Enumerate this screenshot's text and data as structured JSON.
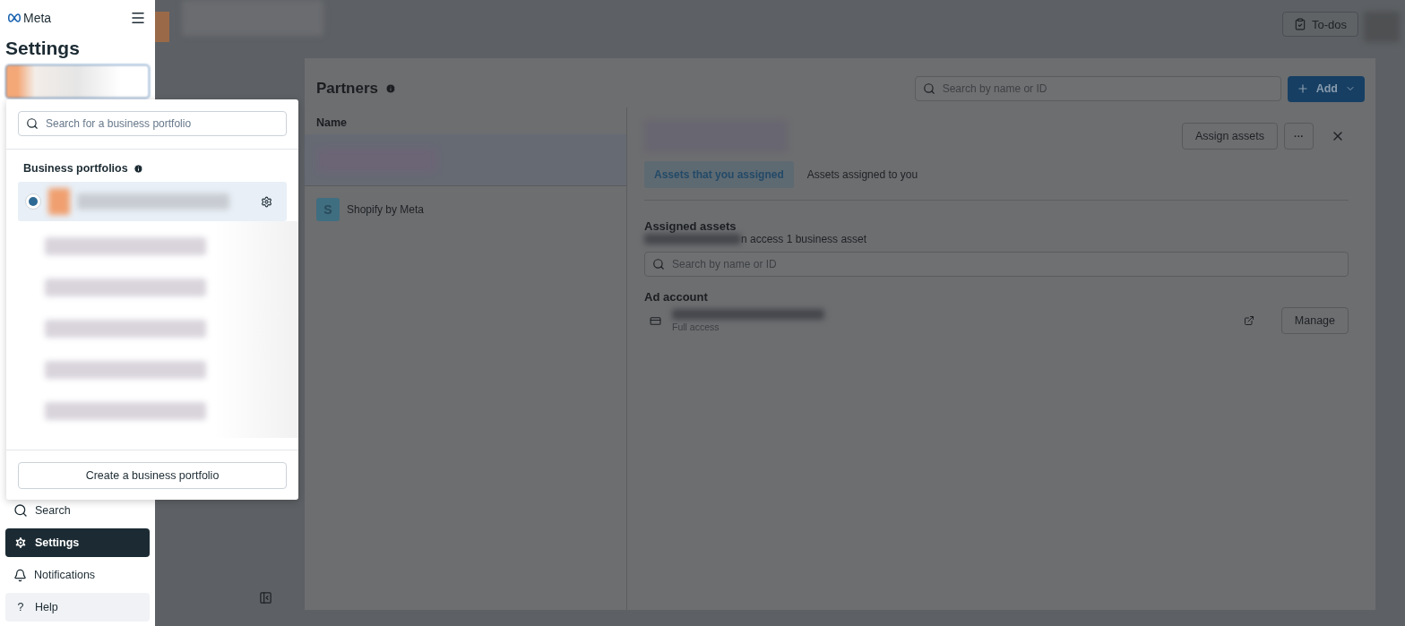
{
  "sidebar": {
    "logo": "Meta",
    "title": "Settings",
    "nav": [
      {
        "label": "Search",
        "selected": false,
        "hovered": false
      },
      {
        "label": "Settings",
        "selected": true,
        "hovered": false
      },
      {
        "label": "Notifications",
        "selected": false,
        "hovered": false
      },
      {
        "glyph": "?",
        "label": "Help",
        "selected": false,
        "hovered": true
      }
    ]
  },
  "topbar": {
    "todos": "To-dos"
  },
  "partners": {
    "title": "Partners",
    "search_placeholder": "Search by name or ID",
    "add": "Add",
    "column": "Name",
    "rows": [
      {
        "selected": true
      },
      {
        "initial": "S",
        "label": "Shopify by Meta",
        "selected": false
      }
    ],
    "detail": {
      "assign": "Assign assets",
      "more": "···",
      "tabs": [
        {
          "label": "Assets that you assigned",
          "selected": true
        },
        {
          "label": "Assets assigned to you",
          "selected": false
        }
      ],
      "section": "Assigned assets",
      "subtitle": "n access 1 business asset",
      "search_placeholder": "Search by name or ID",
      "group": "Ad account",
      "asset_access": "Full access",
      "manage": "Manage"
    }
  },
  "portfolio_menu": {
    "search_placeholder": "Search for a business portfolio",
    "heading": "Business portfolios",
    "portfolios": [
      {
        "selected": true
      }
    ],
    "create": "Create a business portfolio"
  }
}
